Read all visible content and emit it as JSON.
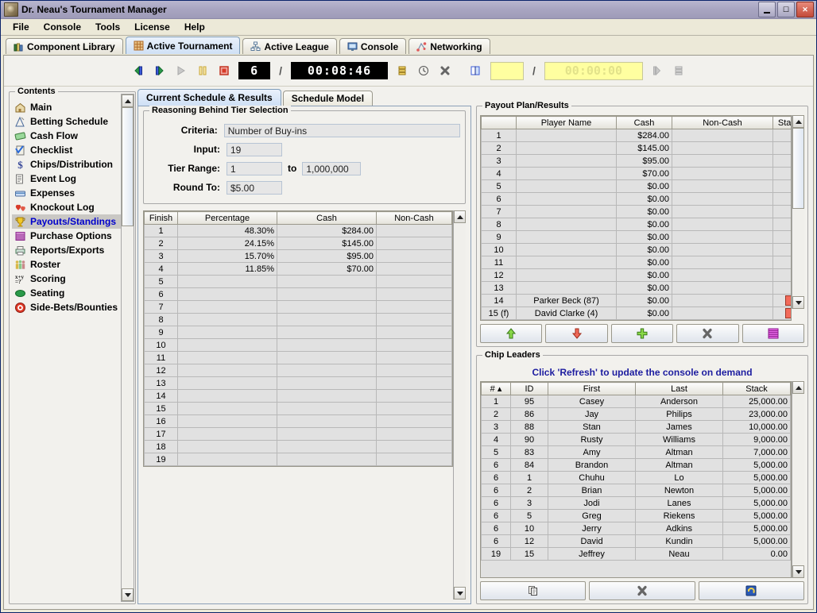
{
  "window": {
    "title": "Dr. Neau's Tournament Manager",
    "minimize": "_",
    "maximize": "❐",
    "close": "✕"
  },
  "menubar": {
    "items": [
      "File",
      "Console",
      "Tools",
      "License",
      "Help"
    ]
  },
  "main_tabs": [
    {
      "label": "Component Library",
      "icon": "books-icon",
      "selected": false
    },
    {
      "label": "Active Tournament",
      "icon": "grid-icon",
      "selected": true
    },
    {
      "label": "Active League",
      "icon": "hierarchy-icon",
      "selected": false
    },
    {
      "label": "Console",
      "icon": "monitor-icon",
      "selected": false
    },
    {
      "label": "Networking",
      "icon": "network-icon",
      "selected": false
    }
  ],
  "toolbar": {
    "buttons": [
      {
        "name": "previous-level-button",
        "icon": "prev-level-icon"
      },
      {
        "name": "next-level-button",
        "icon": "next-level-icon"
      },
      {
        "name": "play-button",
        "icon": "play-icon"
      },
      {
        "name": "pause-button",
        "icon": "pause-icon"
      },
      {
        "name": "stop-button",
        "icon": "stop-icon"
      }
    ],
    "level": "6",
    "separator": "/",
    "clock": "00:08:46",
    "tools": [
      {
        "name": "levels-list-button",
        "icon": "levels-icon"
      },
      {
        "name": "clock-settings-button",
        "icon": "clock-icon"
      },
      {
        "name": "clear-button",
        "icon": "x-icon"
      },
      {
        "name": "book-button",
        "icon": "book-icon"
      }
    ],
    "break_value": "",
    "break_separator": "/",
    "break_clock": "00:00:00",
    "trailing": [
      {
        "name": "break-play-button",
        "icon": "play-icon"
      },
      {
        "name": "break-list-button",
        "icon": "levels-icon"
      }
    ]
  },
  "contents": {
    "title": "Contents",
    "items": [
      {
        "label": "Main",
        "icon": "home-icon",
        "selected": false
      },
      {
        "label": "Betting Schedule",
        "icon": "chart-icon",
        "selected": false
      },
      {
        "label": "Cash Flow",
        "icon": "money-icon",
        "selected": false
      },
      {
        "label": "Checklist",
        "icon": "clipboard-check-icon",
        "selected": false
      },
      {
        "label": "Chips/Distribution",
        "icon": "dollar-icon",
        "selected": false
      },
      {
        "label": "Event Log",
        "icon": "log-icon",
        "selected": false
      },
      {
        "label": "Expenses",
        "icon": "card-icon",
        "selected": false
      },
      {
        "label": "Knockout Log",
        "icon": "hearts-icon",
        "selected": false
      },
      {
        "label": "Payouts/Standings",
        "icon": "trophy-icon",
        "selected": true
      },
      {
        "label": "Purchase Options",
        "icon": "stack-icon",
        "selected": false
      },
      {
        "label": "Reports/Exports",
        "icon": "printer-icon",
        "selected": false
      },
      {
        "label": "Roster",
        "icon": "people-icon",
        "selected": false
      },
      {
        "label": "Scoring",
        "icon": "formula-icon",
        "selected": false
      },
      {
        "label": "Seating",
        "icon": "table-icon",
        "selected": false
      },
      {
        "label": "Side-Bets/Bounties",
        "icon": "target-icon",
        "selected": false
      }
    ]
  },
  "sub_tabs": [
    {
      "label": "Current Schedule & Results",
      "selected": true
    },
    {
      "label": "Schedule Model",
      "selected": false
    }
  ],
  "tier_panel": {
    "title": "Reasoning Behind Tier Selection",
    "fields": [
      {
        "label": "Criteria:",
        "value": "Number of Buy-ins"
      },
      {
        "label": "Input:",
        "value": "19"
      },
      {
        "label": "Tier Range:",
        "value": "1",
        "mid": "to",
        "value2": "1,000,000"
      },
      {
        "label": "Round To:",
        "value": "$5.00"
      }
    ]
  },
  "tier_table": {
    "columns": [
      "Finish",
      "Percentage",
      "Cash",
      "Non-Cash"
    ],
    "rows": [
      {
        "finish": "1",
        "percentage": "48.30%",
        "cash": "$284.00",
        "noncash": ""
      },
      {
        "finish": "2",
        "percentage": "24.15%",
        "cash": "$145.00",
        "noncash": ""
      },
      {
        "finish": "3",
        "percentage": "15.70%",
        "cash": "$95.00",
        "noncash": ""
      },
      {
        "finish": "4",
        "percentage": "11.85%",
        "cash": "$70.00",
        "noncash": ""
      },
      {
        "finish": "5",
        "percentage": "",
        "cash": "",
        "noncash": ""
      },
      {
        "finish": "6",
        "percentage": "",
        "cash": "",
        "noncash": ""
      },
      {
        "finish": "7",
        "percentage": "",
        "cash": "",
        "noncash": ""
      },
      {
        "finish": "8",
        "percentage": "",
        "cash": "",
        "noncash": ""
      },
      {
        "finish": "9",
        "percentage": "",
        "cash": "",
        "noncash": ""
      },
      {
        "finish": "10",
        "percentage": "",
        "cash": "",
        "noncash": ""
      },
      {
        "finish": "11",
        "percentage": "",
        "cash": "",
        "noncash": ""
      },
      {
        "finish": "12",
        "percentage": "",
        "cash": "",
        "noncash": ""
      },
      {
        "finish": "13",
        "percentage": "",
        "cash": "",
        "noncash": ""
      },
      {
        "finish": "14",
        "percentage": "",
        "cash": "",
        "noncash": ""
      },
      {
        "finish": "15",
        "percentage": "",
        "cash": "",
        "noncash": ""
      },
      {
        "finish": "16",
        "percentage": "",
        "cash": "",
        "noncash": ""
      },
      {
        "finish": "17",
        "percentage": "",
        "cash": "",
        "noncash": ""
      },
      {
        "finish": "18",
        "percentage": "",
        "cash": "",
        "noncash": ""
      },
      {
        "finish": "19",
        "percentage": "",
        "cash": "",
        "noncash": ""
      }
    ]
  },
  "payout_panel": {
    "title": "Payout Plan/Results",
    "columns": [
      "",
      "Player Name",
      "Cash",
      "Non-Cash",
      "Status"
    ],
    "rows": [
      {
        "idx": "1",
        "player": "",
        "cash": "$284.00",
        "noncash": "",
        "status": false
      },
      {
        "idx": "2",
        "player": "",
        "cash": "$145.00",
        "noncash": "",
        "status": false
      },
      {
        "idx": "3",
        "player": "",
        "cash": "$95.00",
        "noncash": "",
        "status": false
      },
      {
        "idx": "4",
        "player": "",
        "cash": "$70.00",
        "noncash": "",
        "status": false
      },
      {
        "idx": "5",
        "player": "",
        "cash": "$0.00",
        "noncash": "",
        "status": false
      },
      {
        "idx": "6",
        "player": "",
        "cash": "$0.00",
        "noncash": "",
        "status": false
      },
      {
        "idx": "7",
        "player": "",
        "cash": "$0.00",
        "noncash": "",
        "status": false
      },
      {
        "idx": "8",
        "player": "",
        "cash": "$0.00",
        "noncash": "",
        "status": false
      },
      {
        "idx": "9",
        "player": "",
        "cash": "$0.00",
        "noncash": "",
        "status": false
      },
      {
        "idx": "10",
        "player": "",
        "cash": "$0.00",
        "noncash": "",
        "status": false
      },
      {
        "idx": "11",
        "player": "",
        "cash": "$0.00",
        "noncash": "",
        "status": false
      },
      {
        "idx": "12",
        "player": "",
        "cash": "$0.00",
        "noncash": "",
        "status": false
      },
      {
        "idx": "13",
        "player": "",
        "cash": "$0.00",
        "noncash": "",
        "status": false
      },
      {
        "idx": "14",
        "player": "Parker Beck (87)",
        "cash": "$0.00",
        "noncash": "",
        "status": true
      },
      {
        "idx": "15 (f)",
        "player": "David Clarke (4)",
        "cash": "$0.00",
        "noncash": "",
        "status": true
      }
    ],
    "buttons": [
      {
        "name": "move-up-button",
        "icon": "arrow-up-icon"
      },
      {
        "name": "move-down-button",
        "icon": "arrow-down-icon"
      },
      {
        "name": "add-payout-button",
        "icon": "plus-icon"
      },
      {
        "name": "remove-payout-button",
        "icon": "x-icon"
      },
      {
        "name": "payout-list-button",
        "icon": "stack-icon"
      }
    ]
  },
  "chip_leaders": {
    "title": "Chip Leaders",
    "hint": "Click 'Refresh' to update the console on demand",
    "columns": [
      "# ▴",
      "ID",
      "First",
      "Last",
      "Stack"
    ],
    "rows": [
      {
        "rank": "1",
        "id": "95",
        "first": "Casey",
        "last": "Anderson",
        "stack": "25,000.00"
      },
      {
        "rank": "2",
        "id": "86",
        "first": "Jay",
        "last": "Philips",
        "stack": "23,000.00"
      },
      {
        "rank": "3",
        "id": "88",
        "first": "Stan",
        "last": "James",
        "stack": "10,000.00"
      },
      {
        "rank": "4",
        "id": "90",
        "first": "Rusty",
        "last": "Williams",
        "stack": "9,000.00"
      },
      {
        "rank": "5",
        "id": "83",
        "first": "Amy",
        "last": "Altman",
        "stack": "7,000.00"
      },
      {
        "rank": "6",
        "id": "84",
        "first": "Brandon",
        "last": "Altman",
        "stack": "5,000.00"
      },
      {
        "rank": "6",
        "id": "1",
        "first": "Chuhu",
        "last": "Lo",
        "stack": "5,000.00"
      },
      {
        "rank": "6",
        "id": "2",
        "first": "Brian",
        "last": "Newton",
        "stack": "5,000.00"
      },
      {
        "rank": "6",
        "id": "3",
        "first": "Jodi",
        "last": "Lanes",
        "stack": "5,000.00"
      },
      {
        "rank": "6",
        "id": "5",
        "first": "Greg",
        "last": "Riekens",
        "stack": "5,000.00"
      },
      {
        "rank": "6",
        "id": "10",
        "first": "Jerry",
        "last": "Adkins",
        "stack": "5,000.00"
      },
      {
        "rank": "6",
        "id": "12",
        "first": "David",
        "last": "Kundin",
        "stack": "5,000.00"
      },
      {
        "rank": "19",
        "id": "15",
        "first": "Jeffrey",
        "last": "Neau",
        "stack": "0.00"
      }
    ],
    "buttons": [
      {
        "name": "copy-button",
        "icon": "copy-icon"
      },
      {
        "name": "clear-button",
        "icon": "x-icon"
      },
      {
        "name": "refresh-button",
        "icon": "refresh-icon"
      }
    ]
  },
  "colors": {
    "accent": "#1d1da0",
    "selected_tab": "#cfe0f5",
    "selection_bg": "#cac8c4",
    "lcd_bg": "#000000",
    "lcd_fg": "#ffffff",
    "break_yellow": "#ffffa0",
    "status_red": "#f26a5a"
  }
}
